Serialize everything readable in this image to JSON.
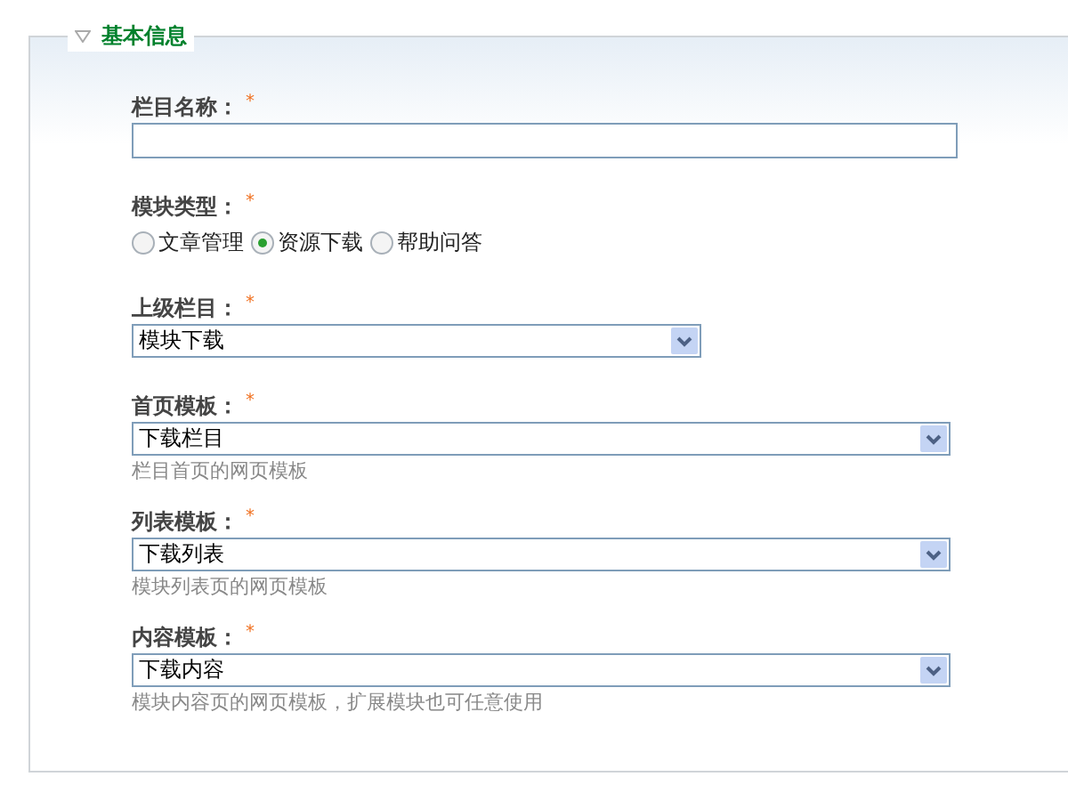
{
  "section": {
    "title": "基本信息",
    "expanded": true
  },
  "fields": [
    {
      "kind": "text",
      "label": "栏目名称：",
      "required": "*"
    },
    {
      "kind": "radio",
      "label": "模块类型：",
      "required": "*",
      "options": [
        {
          "label": "文章管理",
          "selected": false
        },
        {
          "label": "资源下载",
          "selected": true
        },
        {
          "label": "帮助问答",
          "selected": false
        }
      ]
    },
    {
      "kind": "select",
      "label": "上级栏目：",
      "required": "*",
      "value": "模块下载"
    },
    {
      "kind": "select",
      "label": "首页模板：",
      "required": "*",
      "value": "下载栏目",
      "hint": "栏目首页的网页模板"
    },
    {
      "kind": "select",
      "label": "列表模板：",
      "required": "*",
      "value": "下载列表",
      "hint": "模块列表页的网页模板"
    },
    {
      "kind": "select",
      "label": "内容模板：",
      "required": "*",
      "value": "下载内容",
      "hint": "模块内容页的网页模板，扩展模块也可任意使用"
    }
  ]
}
